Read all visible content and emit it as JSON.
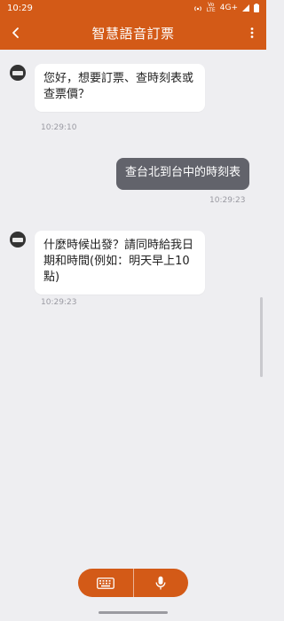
{
  "status_bar": {
    "time": "10:29",
    "network_label": "4G+",
    "volte_label": "Vo LTE",
    "icons": [
      "hotspot-icon",
      "volte-icon",
      "signal-icon",
      "battery-icon"
    ]
  },
  "app_bar": {
    "title": "智慧語音訂票",
    "back_icon": "chevron-left-icon",
    "more_icon": "more-vertical-icon"
  },
  "messages": [
    {
      "from": "bot",
      "text": "您好，想要訂票、查時刻表或查票價？",
      "time": "10:29:10"
    },
    {
      "from": "user",
      "text": "查台北到台中的時刻表",
      "time": "10:29:23"
    },
    {
      "from": "bot",
      "text": "什麼時候出發？請同時給我日期和時間(例如：明天早上10點)",
      "time": "10:29:23"
    }
  ],
  "input_bar": {
    "left_icon": "keyboard-icon",
    "right_icon": "microphone-icon"
  },
  "colors": {
    "accent": "#d35a17",
    "background": "#eeeef1",
    "user_bubble": "#62636b",
    "bot_bubble": "#ffffff",
    "timestamp": "#9a9aa2"
  }
}
